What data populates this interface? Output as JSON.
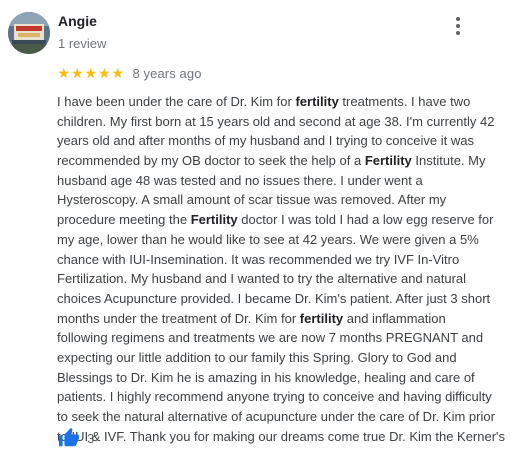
{
  "reviewer": {
    "name": "Angie",
    "review_count": "1 review"
  },
  "rating": {
    "stars": 5,
    "max_stars": 5,
    "time_ago": "8 years ago"
  },
  "review": {
    "lines": [
      [
        {
          "t": "I have been under the care of Dr. Kim for "
        },
        {
          "t": "fertility",
          "b": true
        },
        {
          "t": " treatments. I have two"
        }
      ],
      [
        {
          "t": "children. My first born at 15 years old and second at age 38. I'm currently 42"
        }
      ],
      [
        {
          "t": "years old and after months of my husband and I trying to conceive it was"
        }
      ],
      [
        {
          "t": "recommended by my OB doctor to seek the help of a "
        },
        {
          "t": "Fertility",
          "b": true
        },
        {
          "t": " Institute. My"
        }
      ],
      [
        {
          "t": "husband age 48 was tested and no issues there. I under went a"
        }
      ],
      [
        {
          "t": "Hysteroscopy. A small amount of scar tissue was removed. After my"
        }
      ],
      [
        {
          "t": "procedure meeting the "
        },
        {
          "t": "Fertility",
          "b": true
        },
        {
          "t": " doctor I was told I had a low egg reserve for"
        }
      ],
      [
        {
          "t": "my age, lower than he would like to see at 42 years. We were given a 5%"
        }
      ],
      [
        {
          "t": "chance with IUI-Insemination. It was recommended we try IVF In-Vitro"
        }
      ],
      [
        {
          "t": "Fertilization. My husband and I wanted to try the alternative and natural"
        }
      ],
      [
        {
          "t": "choices Acupuncture provided. I became Dr. Kim's patient. After just 3 short"
        }
      ],
      [
        {
          "t": "months under the treatment of Dr. Kim for "
        },
        {
          "t": "fertility",
          "b": true
        },
        {
          "t": " and inflammation"
        }
      ],
      [
        {
          "t": "following regimens and treatments we are now 7 months PREGNANT and"
        }
      ],
      [
        {
          "t": "expecting our little addition to our family this Spring. Glory to God and"
        }
      ],
      [
        {
          "t": "Blessings to Dr. Kim he is amazing in his knowledge, healing and care of"
        }
      ],
      [
        {
          "t": "patients. I highly recommend anyone trying to conceive and having difficulty"
        }
      ],
      [
        {
          "t": "to seek the natural alternative of acupuncture under the care of Dr. Kim prior"
        }
      ],
      [
        {
          "t": "to IUI & IVF. Thank you for making our dreams come true Dr. Kim the Kerner's"
        }
      ]
    ]
  },
  "likes": {
    "count": "3"
  },
  "colors": {
    "star": "#fbbc04",
    "like_icon": "#1a73e8",
    "secondary_text": "#70757a"
  }
}
